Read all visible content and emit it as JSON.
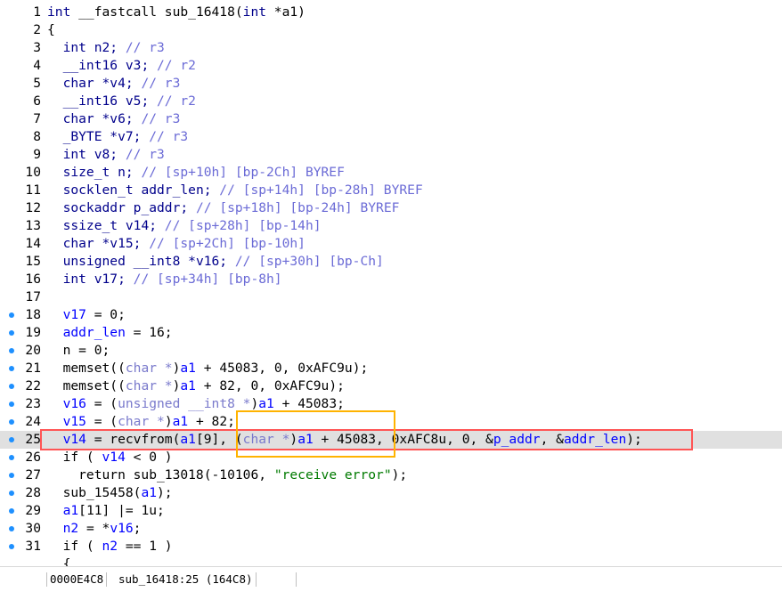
{
  "editor": {
    "lines": [
      {
        "n": "1",
        "dot": false,
        "tokens": [
          [
            "kw",
            "int"
          ],
          [
            "black",
            " __fastcall sub_16418("
          ],
          [
            "kw",
            "int"
          ],
          [
            "black",
            " *a1)"
          ]
        ]
      },
      {
        "n": "2",
        "dot": false,
        "tokens": [
          [
            "black",
            "{"
          ]
        ]
      },
      {
        "n": "3",
        "dot": false,
        "tokens": [
          [
            "black",
            "  "
          ],
          [
            "norm",
            "int n2;"
          ],
          [
            "cmt",
            " // r3"
          ]
        ]
      },
      {
        "n": "4",
        "dot": false,
        "tokens": [
          [
            "black",
            "  "
          ],
          [
            "norm",
            "__int16 v3;"
          ],
          [
            "cmt",
            " // r2"
          ]
        ]
      },
      {
        "n": "5",
        "dot": false,
        "tokens": [
          [
            "black",
            "  "
          ],
          [
            "norm",
            "char *v4;"
          ],
          [
            "cmt",
            " // r3"
          ]
        ]
      },
      {
        "n": "6",
        "dot": false,
        "tokens": [
          [
            "black",
            "  "
          ],
          [
            "norm",
            "__int16 v5;"
          ],
          [
            "cmt",
            " // r2"
          ]
        ]
      },
      {
        "n": "7",
        "dot": false,
        "tokens": [
          [
            "black",
            "  "
          ],
          [
            "norm",
            "char *v6;"
          ],
          [
            "cmt",
            " // r3"
          ]
        ]
      },
      {
        "n": "8",
        "dot": false,
        "tokens": [
          [
            "black",
            "  "
          ],
          [
            "norm",
            "_BYTE *v7;"
          ],
          [
            "cmt",
            " // r3"
          ]
        ]
      },
      {
        "n": "9",
        "dot": false,
        "tokens": [
          [
            "black",
            "  "
          ],
          [
            "kw",
            "int v8;"
          ],
          [
            "cmt",
            " // r3"
          ]
        ]
      },
      {
        "n": "10",
        "dot": false,
        "tokens": [
          [
            "black",
            "  "
          ],
          [
            "kw",
            "size_t n;"
          ],
          [
            "cmt",
            " // [sp+10h] [bp-2Ch] BYREF"
          ]
        ]
      },
      {
        "n": "11",
        "dot": false,
        "tokens": [
          [
            "black",
            "  "
          ],
          [
            "kw",
            "socklen_t addr_len;"
          ],
          [
            "cmt",
            " // [sp+14h] [bp-28h] BYREF"
          ]
        ]
      },
      {
        "n": "12",
        "dot": false,
        "tokens": [
          [
            "black",
            "  "
          ],
          [
            "kw",
            "sockaddr p_addr;"
          ],
          [
            "cmt",
            " // [sp+18h] [bp-24h] BYREF"
          ]
        ]
      },
      {
        "n": "13",
        "dot": false,
        "tokens": [
          [
            "black",
            "  "
          ],
          [
            "kw",
            "ssize_t v14;"
          ],
          [
            "cmt",
            " // [sp+28h] [bp-14h]"
          ]
        ]
      },
      {
        "n": "14",
        "dot": false,
        "tokens": [
          [
            "black",
            "  "
          ],
          [
            "norm",
            "char *v15;"
          ],
          [
            "cmt",
            " // [sp+2Ch] [bp-10h]"
          ]
        ]
      },
      {
        "n": "15",
        "dot": false,
        "tokens": [
          [
            "black",
            "  "
          ],
          [
            "norm",
            "unsigned __int8 *v16;"
          ],
          [
            "cmt",
            " // [sp+30h] [bp-Ch]"
          ]
        ]
      },
      {
        "n": "16",
        "dot": false,
        "tokens": [
          [
            "black",
            "  "
          ],
          [
            "kw",
            "int v17;"
          ],
          [
            "cmt",
            " // [sp+34h] [bp-8h]"
          ]
        ]
      },
      {
        "n": "17",
        "dot": false,
        "tokens": []
      },
      {
        "n": "18",
        "dot": true,
        "tokens": [
          [
            "black",
            "  "
          ],
          [
            "var",
            "v17"
          ],
          [
            "black",
            " = 0;"
          ]
        ]
      },
      {
        "n": "19",
        "dot": true,
        "tokens": [
          [
            "black",
            "  "
          ],
          [
            "var",
            "addr_len"
          ],
          [
            "black",
            " = 16;"
          ]
        ]
      },
      {
        "n": "20",
        "dot": true,
        "tokens": [
          [
            "black",
            "  n = 0;"
          ]
        ]
      },
      {
        "n": "21",
        "dot": true,
        "tokens": [
          [
            "black",
            "  memset(("
          ],
          [
            "typecast",
            "char *"
          ],
          [
            "black",
            ")"
          ],
          [
            "var",
            "a1"
          ],
          [
            "black",
            " + 45083, 0, 0xAFC9u);"
          ]
        ]
      },
      {
        "n": "22",
        "dot": true,
        "tokens": [
          [
            "black",
            "  memset(("
          ],
          [
            "typecast",
            "char *"
          ],
          [
            "black",
            ")"
          ],
          [
            "var",
            "a1"
          ],
          [
            "black",
            " + 82, 0, 0xAFC9u);"
          ]
        ]
      },
      {
        "n": "23",
        "dot": true,
        "tokens": [
          [
            "black",
            "  "
          ],
          [
            "var",
            "v16"
          ],
          [
            "black",
            " = ("
          ],
          [
            "typecast",
            "unsigned __int8 *"
          ],
          [
            "black",
            ")"
          ],
          [
            "var",
            "a1"
          ],
          [
            "black",
            " + 45083;"
          ]
        ]
      },
      {
        "n": "24",
        "dot": true,
        "tokens": [
          [
            "black",
            "  "
          ],
          [
            "var",
            "v15"
          ],
          [
            "black",
            " = ("
          ],
          [
            "typecast",
            "char *"
          ],
          [
            "black",
            ")"
          ],
          [
            "var",
            "a1"
          ],
          [
            "black",
            " + 82;"
          ]
        ]
      },
      {
        "n": "25",
        "dot": true,
        "current": true,
        "tokens": [
          [
            "black",
            "  "
          ],
          [
            "var",
            "v14"
          ],
          [
            "black",
            " = recvfrom("
          ],
          [
            "var",
            "a1"
          ],
          [
            "black",
            "[9], ("
          ],
          [
            "typecast",
            "char *"
          ],
          [
            "black",
            ")"
          ],
          [
            "var",
            "a1"
          ],
          [
            "black",
            " + 45083, 0xAFC8u, 0, &"
          ],
          [
            "var",
            "p_addr"
          ],
          [
            "black",
            ", &"
          ],
          [
            "var",
            "addr_len"
          ],
          [
            "black",
            ");"
          ]
        ]
      },
      {
        "n": "26",
        "dot": true,
        "tokens": [
          [
            "black",
            "  if ( "
          ],
          [
            "var",
            "v14"
          ],
          [
            "black",
            " < 0 )"
          ]
        ]
      },
      {
        "n": "27",
        "dot": true,
        "tokens": [
          [
            "black",
            "    return sub_13018(-10106, "
          ],
          [
            "str",
            "\"receive error\""
          ],
          [
            "black",
            ");"
          ]
        ]
      },
      {
        "n": "28",
        "dot": true,
        "tokens": [
          [
            "black",
            "  sub_15458("
          ],
          [
            "var",
            "a1"
          ],
          [
            "black",
            ");"
          ]
        ]
      },
      {
        "n": "29",
        "dot": true,
        "tokens": [
          [
            "black",
            "  "
          ],
          [
            "var",
            "a1"
          ],
          [
            "black",
            "[11] |= 1u;"
          ]
        ]
      },
      {
        "n": "30",
        "dot": true,
        "tokens": [
          [
            "black",
            "  "
          ],
          [
            "var",
            "n2"
          ],
          [
            "black",
            " = *"
          ],
          [
            "var",
            "v16"
          ],
          [
            "black",
            ";"
          ]
        ]
      },
      {
        "n": "31",
        "dot": true,
        "tokens": [
          [
            "black",
            "  if ( "
          ],
          [
            "var",
            "n2"
          ],
          [
            "black",
            " == 1 )"
          ]
        ]
      },
      {
        "n": "",
        "dot": false,
        "tokens": [
          [
            "black",
            "  {"
          ]
        ]
      }
    ]
  },
  "statusbar": {
    "address": "0000E4C8",
    "location": "sub_16418:25 (164C8)"
  },
  "colors": {
    "highlight_red": "#ff5555",
    "highlight_orange": "#ffb300",
    "current_line_bg": "#e0e0e0",
    "gutter_dot": "#1e90ff"
  }
}
